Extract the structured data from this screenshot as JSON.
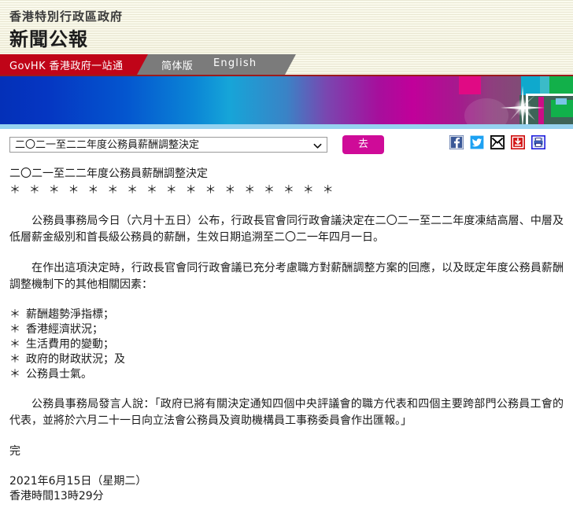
{
  "header": {
    "org_line": "香港特別行政區政府",
    "title_line": "新聞公報"
  },
  "nav": {
    "govhk": "GovHK 香港政府一站通",
    "simplified": "简体版",
    "english": "English"
  },
  "toolbar": {
    "select_value": "二〇二一至二二年度公務員薪酬調整決定",
    "go_label": "去",
    "icons": [
      "facebook-icon",
      "twitter-icon",
      "email-icon",
      "download-icon",
      "print-icon"
    ]
  },
  "article": {
    "title": "二〇二一至二二年度公務員薪酬調整決定",
    "separator": "＊ ＊ ＊ ＊ ＊ ＊ ＊ ＊ ＊ ＊ ＊ ＊ ＊ ＊ ＊ ＊ ＊",
    "para1": "公務員事務局今日（六月十五日）公布，行政長官會同行政會議決定在二〇二一至二二年度凍結高層、中層及低層薪金級別和首長級公務員的薪酬，生效日期追溯至二〇二一年四月一日。",
    "para2": "在作出這項決定時，行政長官會同行政會議已充分考慮職方對薪酬調整方案的回應，以及既定年度公務員薪酬調整機制下的其他相關因素：",
    "bullets": [
      "薪酬趨勢淨指標；",
      "香港經濟狀況；",
      "生活費用的變動；",
      "政府的財政狀況；及",
      "公務員士氣。"
    ],
    "bullet_mark": "＊",
    "para3": "公務員事務局發言人說：「政府已將有關決定通知四個中央評議會的職方代表和四個主要跨部門公務員工會的代表，並將於六月二十一日向立法會公務員及資助機構員工事務委員會作出匯報。」",
    "end_mark": "完",
    "date": "2021年6月15日（星期二）",
    "time": "香港時間13時29分"
  },
  "colors": {
    "nav_red": "#c00418",
    "nav_gray": "#7b7b7b",
    "go_button": "#cf0b98",
    "banner_blue": "#0430b8",
    "banner_magenta": "#c1009a"
  }
}
